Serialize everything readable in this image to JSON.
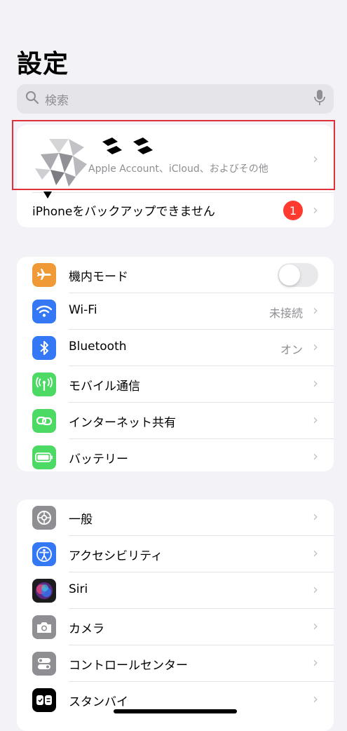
{
  "header": {
    "title": "設定"
  },
  "search": {
    "placeholder": "検索"
  },
  "account": {
    "subtitle": "Apple Account、iCloud、およびその他"
  },
  "backup": {
    "label": "iPhoneをバックアップできません",
    "badge": "1"
  },
  "connectivity": [
    {
      "label": "機内モード",
      "icon": "airplane-icon",
      "color": "#f09a37",
      "toggle": false
    },
    {
      "label": "Wi-Fi",
      "icon": "wifi-icon",
      "color": "#3478f6",
      "value": "未接続"
    },
    {
      "label": "Bluetooth",
      "icon": "bluetooth-icon",
      "color": "#3478f6",
      "value": "オン"
    },
    {
      "label": "モバイル通信",
      "icon": "antenna-icon",
      "color": "#4cd964"
    },
    {
      "label": "インターネット共有",
      "icon": "link-icon",
      "color": "#4cd964"
    },
    {
      "label": "バッテリー",
      "icon": "battery-icon",
      "color": "#4cd964"
    }
  ],
  "general": [
    {
      "label": "一般",
      "icon": "gear-icon",
      "color": "#8e8e93"
    },
    {
      "label": "アクセシビリティ",
      "icon": "accessibility-icon",
      "color": "#3478f6"
    },
    {
      "label": "Siri",
      "icon": "siri-icon",
      "color": "#1c1c1e"
    },
    {
      "label": "カメラ",
      "icon": "camera-icon",
      "color": "#8e8e93"
    },
    {
      "label": "コントロールセンター",
      "icon": "switches-icon",
      "color": "#8e8e93"
    },
    {
      "label": "スタンバイ",
      "icon": "standby-icon",
      "color": "#000000"
    }
  ]
}
